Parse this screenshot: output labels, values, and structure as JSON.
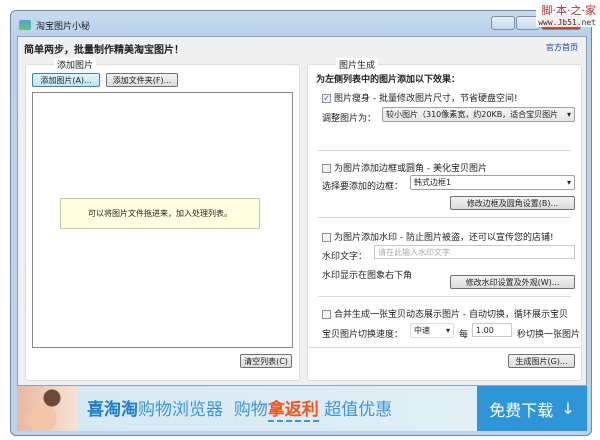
{
  "window": {
    "title": "淘宝图片小秘"
  },
  "watermark": {
    "line1": "脚本之家",
    "line2": "www.Jb51.net"
  },
  "header": {
    "headline": "简单两步，批量制作精美淘宝图片！",
    "home_link": "官方首页"
  },
  "left": {
    "group_label": "添加图片",
    "add_images": "添加图片(A)...",
    "add_folder": "添加文件夹(F)...",
    "hint": "可以将图片文件拖进来，加入处理列表。",
    "clear": "清空列表(C)"
  },
  "right": {
    "group_label": "图片生成",
    "intro": "为左侧列表中的图片添加以下效果：",
    "resize": {
      "checked": true,
      "label": "图片瘦身 - 批量修改图片尺寸，节省硬盘空间!",
      "size_label": "调整图片为：",
      "size_value": "较小图片（310像素宽，约20KB，适合宝贝图片"
    },
    "border": {
      "checked": false,
      "label": "为图片添加边框或圆角 - 美化宝贝图片",
      "select_label": "选择要添加的边框：",
      "select_value": "韩式边框1",
      "settings": "修改边框及圆角设置(B)..."
    },
    "watermark": {
      "checked": false,
      "label": "为图片添加水印 - 防止图片被盗，还可以宣传您的店铺!",
      "text_label": "水印文字：",
      "text_placeholder": "请在此输入水印文字",
      "text_value": "",
      "position_note": "水印显示在图象右下角",
      "settings": "修改水印设置及外观(W)..."
    },
    "animate": {
      "checked": false,
      "label": "合并生成一张宝贝动态展示图片 - 自动切换，循环展示宝贝",
      "speed_label": "宝贝图片切换速度：",
      "speed_value": "中速",
      "every": "每",
      "seconds": "1.00",
      "seconds_suffix": "秒切换一张图片"
    },
    "generate": "生成图片(G)..."
  },
  "banner": {
    "brand": "喜淘淘",
    "product": "购物浏览器",
    "slogan1": "购物",
    "slogan2": "拿返利",
    "slogan3": "超值优惠",
    "download": "免费下载",
    "accent": "#2e95d8"
  }
}
